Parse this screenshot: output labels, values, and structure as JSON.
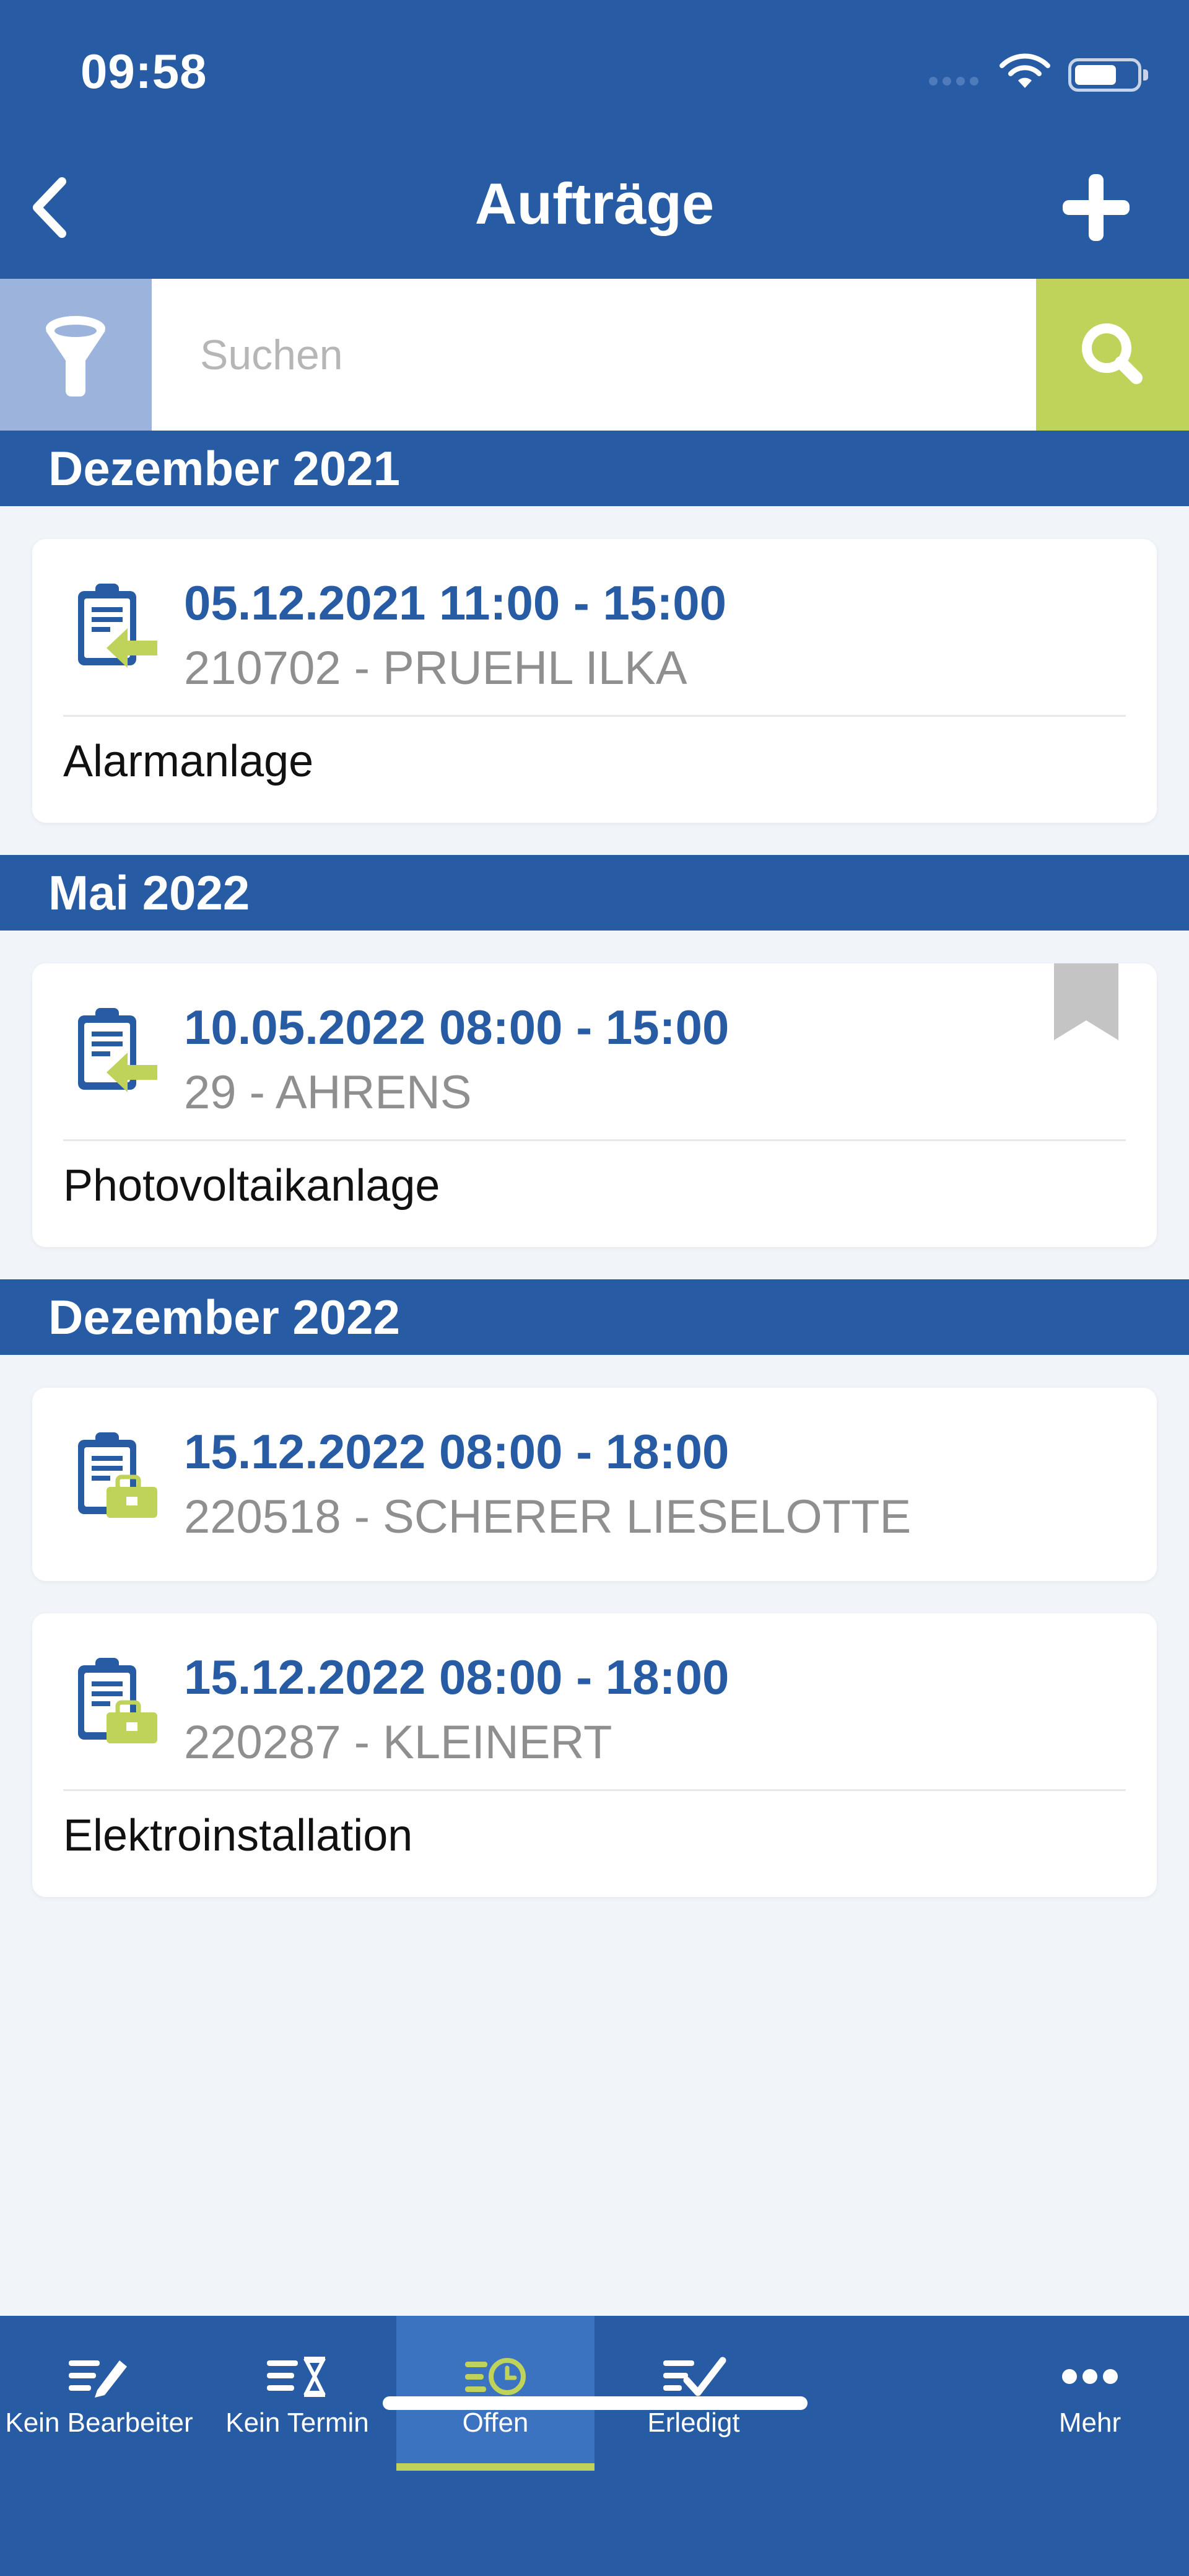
{
  "status": {
    "time": "09:58"
  },
  "header": {
    "title": "Aufträge"
  },
  "search": {
    "placeholder": "Suchen"
  },
  "sections": [
    {
      "label": "Dezember 2021"
    },
    {
      "label": "Mai 2022"
    },
    {
      "label": "Dezember 2022"
    }
  ],
  "cards": [
    {
      "date": "05.12.2021 11:00 - 15:00",
      "customer": "210702 - PRUEHL ILKA",
      "description": "Alarmanlage",
      "icon": "clipboard-arrow-icon"
    },
    {
      "date": "10.05.2022 08:00 - 15:00",
      "customer": "29 - AHRENS",
      "description": "Photovoltaikanlage",
      "icon": "clipboard-arrow-icon",
      "bookmark": "bookmark-icon"
    },
    {
      "date": "15.12.2022 08:00 - 18:00",
      "customer": "220518 - SCHERER LIESELOTTE",
      "description": "",
      "icon": "clipboard-briefcase-icon"
    },
    {
      "date": "15.12.2022 08:00 - 18:00",
      "customer": "220287 - KLEINERT",
      "description": "Elektroinstallation",
      "icon": "clipboard-briefcase-icon"
    }
  ],
  "tabs": [
    {
      "label": "Kein Bearbeiter",
      "icon": "list-pen-icon",
      "active": false
    },
    {
      "label": "Kein Termin",
      "icon": "list-hourglass-icon",
      "active": false
    },
    {
      "label": "Offen",
      "icon": "list-clock-icon",
      "active": true
    },
    {
      "label": "Erledigt",
      "icon": "list-check-icon",
      "active": false
    },
    {
      "label": "Mehr",
      "icon": "more-dots-icon",
      "active": false
    }
  ],
  "colors": {
    "primary": "#275ba3",
    "accent": "#bfd25a",
    "filter": "#9cb3dc",
    "background": "#f1f4f8",
    "secondary_text": "#8f8f8f"
  }
}
